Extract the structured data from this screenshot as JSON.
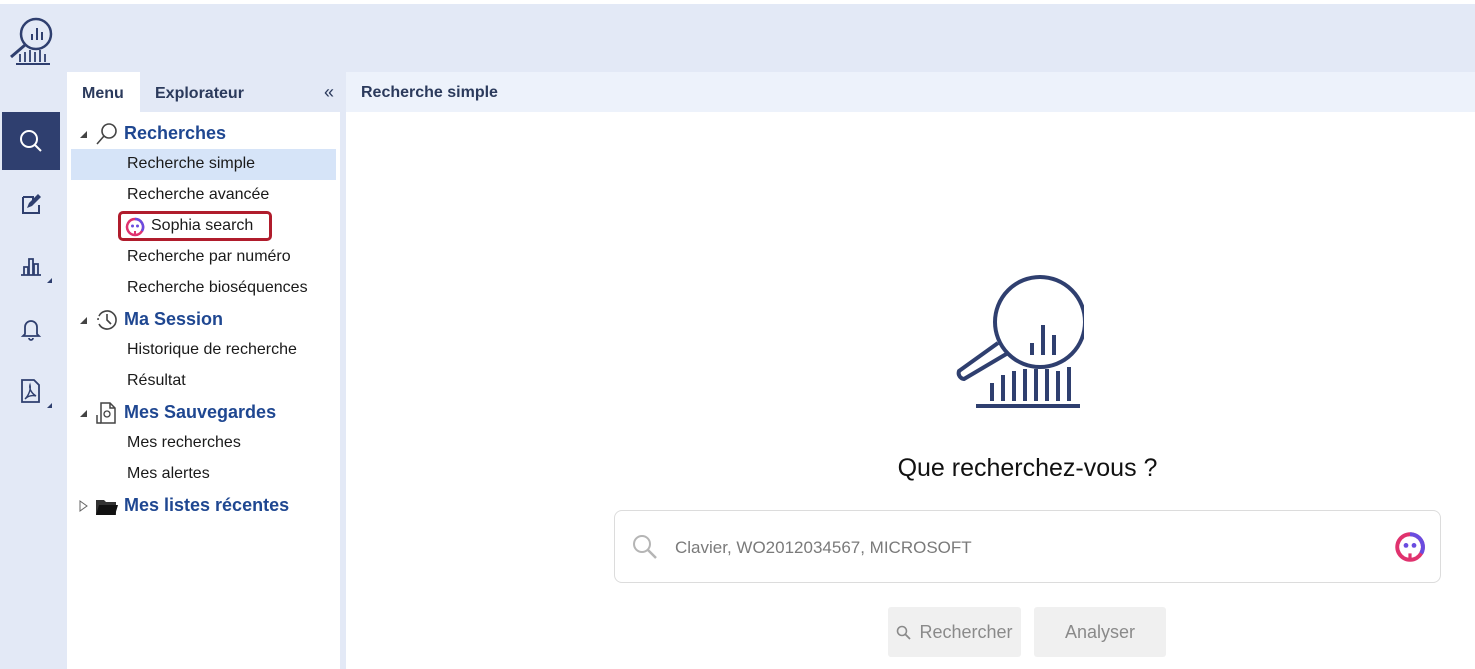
{
  "panel": {
    "tabs": [
      {
        "label": "Menu"
      },
      {
        "label": "Explorateur"
      }
    ],
    "collapse_label": "«"
  },
  "tree": {
    "groups": [
      {
        "label": "Recherches",
        "icon": "search-icon",
        "expanded": true,
        "items": [
          {
            "label": "Recherche simple",
            "selected": true
          },
          {
            "label": "Recherche avancée"
          },
          {
            "label": "Sophia search",
            "icon": "sophia-icon",
            "highlighted": true
          },
          {
            "label": "Recherche par numéro"
          },
          {
            "label": "Recherche bioséquences"
          }
        ]
      },
      {
        "label": "Ma Session",
        "icon": "history-clock-icon",
        "expanded": true,
        "items": [
          {
            "label": "Historique de recherche"
          },
          {
            "label": "Résultat"
          }
        ]
      },
      {
        "label": "Mes Sauvegardes",
        "icon": "saved-document-icon",
        "expanded": true,
        "items": [
          {
            "label": "Mes recherches"
          },
          {
            "label": "Mes alertes"
          }
        ]
      },
      {
        "label": "Mes listes récentes",
        "icon": "folder-icon",
        "expanded": false,
        "items": []
      }
    ]
  },
  "rail": {
    "items": [
      {
        "icon": "search-icon",
        "active": true
      },
      {
        "icon": "edit-document-icon"
      },
      {
        "icon": "bar-chart-icon"
      },
      {
        "icon": "bell-icon"
      },
      {
        "icon": "pdf-icon"
      }
    ]
  },
  "main": {
    "tab_label": "Recherche simple",
    "question": "Que recherchez-vous ?",
    "search": {
      "placeholder": "Clavier, WO2012034567, MICROSOFT",
      "value": ""
    },
    "buttons": {
      "search_label": "Rechercher",
      "analyse_label": "Analyser"
    }
  },
  "colors": {
    "brand_navy": "#2f3f6f",
    "link_blue": "#1f4791",
    "chrome_bg": "#e3e9f6",
    "selected_bg": "#d6e4f8",
    "highlight_border": "#b01c2c"
  }
}
